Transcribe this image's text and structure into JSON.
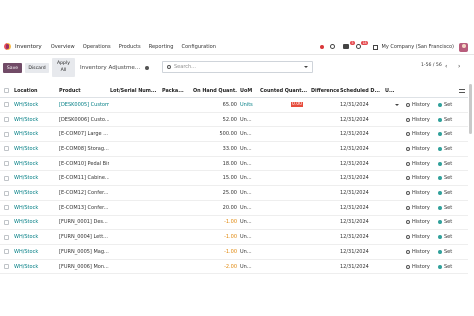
{
  "navbar": {
    "app_name": "Inventory",
    "menu": [
      "Overview",
      "Operations",
      "Products",
      "Reporting",
      "Configuration"
    ],
    "chat_badge": "5",
    "activity_badge": "18",
    "company": "My Company (San Francisco)"
  },
  "control": {
    "save_label": "Save",
    "discard_label": "Discard",
    "apply_line1": "Apply",
    "apply_line2": "All",
    "breadcrumb": "Inventory Adjustme...",
    "search_placeholder": "Search...",
    "pager": "1-56 / 56",
    "prev": "‹",
    "next": "›"
  },
  "table": {
    "headers": [
      "Location",
      "Product",
      "Lot/Serial Num...",
      "Packa...",
      "On Hand Quant...",
      "UoM",
      "Counted Quant...",
      "Difference",
      "Scheduled D...",
      "U..."
    ],
    "rows": [
      {
        "location": "WH/Stock",
        "product": "[DESK0005] Customiz",
        "onhand": "65.00",
        "uom": "Units",
        "counted": "0.00",
        "date": "12/31/2024",
        "hist": "History",
        "set": "Set"
      },
      {
        "location": "WH/Stock",
        "product": "[DESK0006] Custo...",
        "onhand": "52.00",
        "uom": "Un...",
        "counted": "",
        "date": "12/31/2024",
        "hist": "History",
        "set": "Set"
      },
      {
        "location": "WH/Stock",
        "product": "[E-COM07] Large ...",
        "onhand": "500.00",
        "uom": "Un...",
        "counted": "",
        "date": "12/31/2024",
        "hist": "History",
        "set": "Set"
      },
      {
        "location": "WH/Stock",
        "product": "[E-COM08] Storag...",
        "onhand": "33.00",
        "uom": "Un...",
        "counted": "",
        "date": "12/31/2024",
        "hist": "History",
        "set": "Set"
      },
      {
        "location": "WH/Stock",
        "product": "[E-COM10] Pedal Bin",
        "onhand": "18.00",
        "uom": "Un...",
        "counted": "",
        "date": "12/31/2024",
        "hist": "History",
        "set": "Set"
      },
      {
        "location": "WH/Stock",
        "product": "[E-COM11] Cabine...",
        "onhand": "15.00",
        "uom": "Un...",
        "counted": "",
        "date": "12/31/2024",
        "hist": "History",
        "set": "Set"
      },
      {
        "location": "WH/Stock",
        "product": "[E-COM12] Confer...",
        "onhand": "25.00",
        "uom": "Un...",
        "counted": "",
        "date": "12/31/2024",
        "hist": "History",
        "set": "Set"
      },
      {
        "location": "WH/Stock",
        "product": "[E-COM13] Confer...",
        "onhand": "20.00",
        "uom": "Un...",
        "counted": "",
        "date": "12/31/2024",
        "hist": "History",
        "set": "Set"
      },
      {
        "location": "WH/Stock",
        "product": "[FURN_0001] Des...",
        "onhand": "-1.00",
        "uom": "Un...",
        "counted": "",
        "date": "12/31/2024",
        "hist": "History",
        "set": "Set"
      },
      {
        "location": "WH/Stock",
        "product": "[FURN_0004] Lett...",
        "onhand": "-1.00",
        "uom": "Un...",
        "counted": "",
        "date": "12/31/2024",
        "hist": "History",
        "set": "Set"
      },
      {
        "location": "WH/Stock",
        "product": "[FURN_0005] Mag...",
        "onhand": "-1.00",
        "uom": "Un...",
        "counted": "",
        "date": "12/31/2024",
        "hist": "History",
        "set": "Set"
      },
      {
        "location": "WH/Stock",
        "product": "[FURN_0006] Mon...",
        "onhand": "-2.00",
        "uom": "Un...",
        "counted": "",
        "date": "12/31/2024",
        "hist": "History",
        "set": "Set"
      }
    ]
  },
  "colors": {
    "brand": "#714b67",
    "link": "#017e84",
    "negative": "#e0870a",
    "alert": "#e74c3c"
  }
}
